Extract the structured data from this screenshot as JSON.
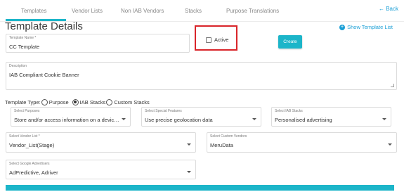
{
  "tabs": [
    {
      "label": "Templates"
    },
    {
      "label": "Vendor Lists"
    },
    {
      "label": "Non IAB Vendors"
    },
    {
      "label": "Stacks"
    },
    {
      "label": "Purpose Translations"
    }
  ],
  "back_link": "← Back",
  "page_title": "Template Details",
  "show_template_list": "Show Template List",
  "template_name": {
    "label": "Template Name *",
    "value": "CC Template"
  },
  "active": {
    "label": "Active",
    "checked": false
  },
  "create_button": "Create",
  "description": {
    "label": "Description",
    "value": "IAB Compliant Cookie Banner"
  },
  "template_type": {
    "label": "Template Type:",
    "options": [
      "Purpose",
      "IAB Stacks",
      "Custom Stacks"
    ],
    "selected": "IAB Stacks"
  },
  "select_purposes": {
    "label": "Select Purposes",
    "value": "Store and/or access information on a device-Purp..."
  },
  "select_special_features": {
    "label": "Select Special Features",
    "value": "Use precise geolocation data"
  },
  "select_iab_stacks": {
    "label": "Select IAB Stacks",
    "value": "Personalised advertising"
  },
  "select_vendor_list": {
    "label": "Select Vendor List *",
    "value": "Vendor_List(Stage)"
  },
  "select_custom_vendors": {
    "label": "Select Custom Vendors",
    "value": "MeruData"
  },
  "select_google_advertisers": {
    "label": "Select Google Advertisers",
    "value": "AdPredictive, Adriver"
  },
  "colors": {
    "accent": "#1cb5c9",
    "link": "#1a9fd6",
    "highlight": "#d9252a"
  }
}
